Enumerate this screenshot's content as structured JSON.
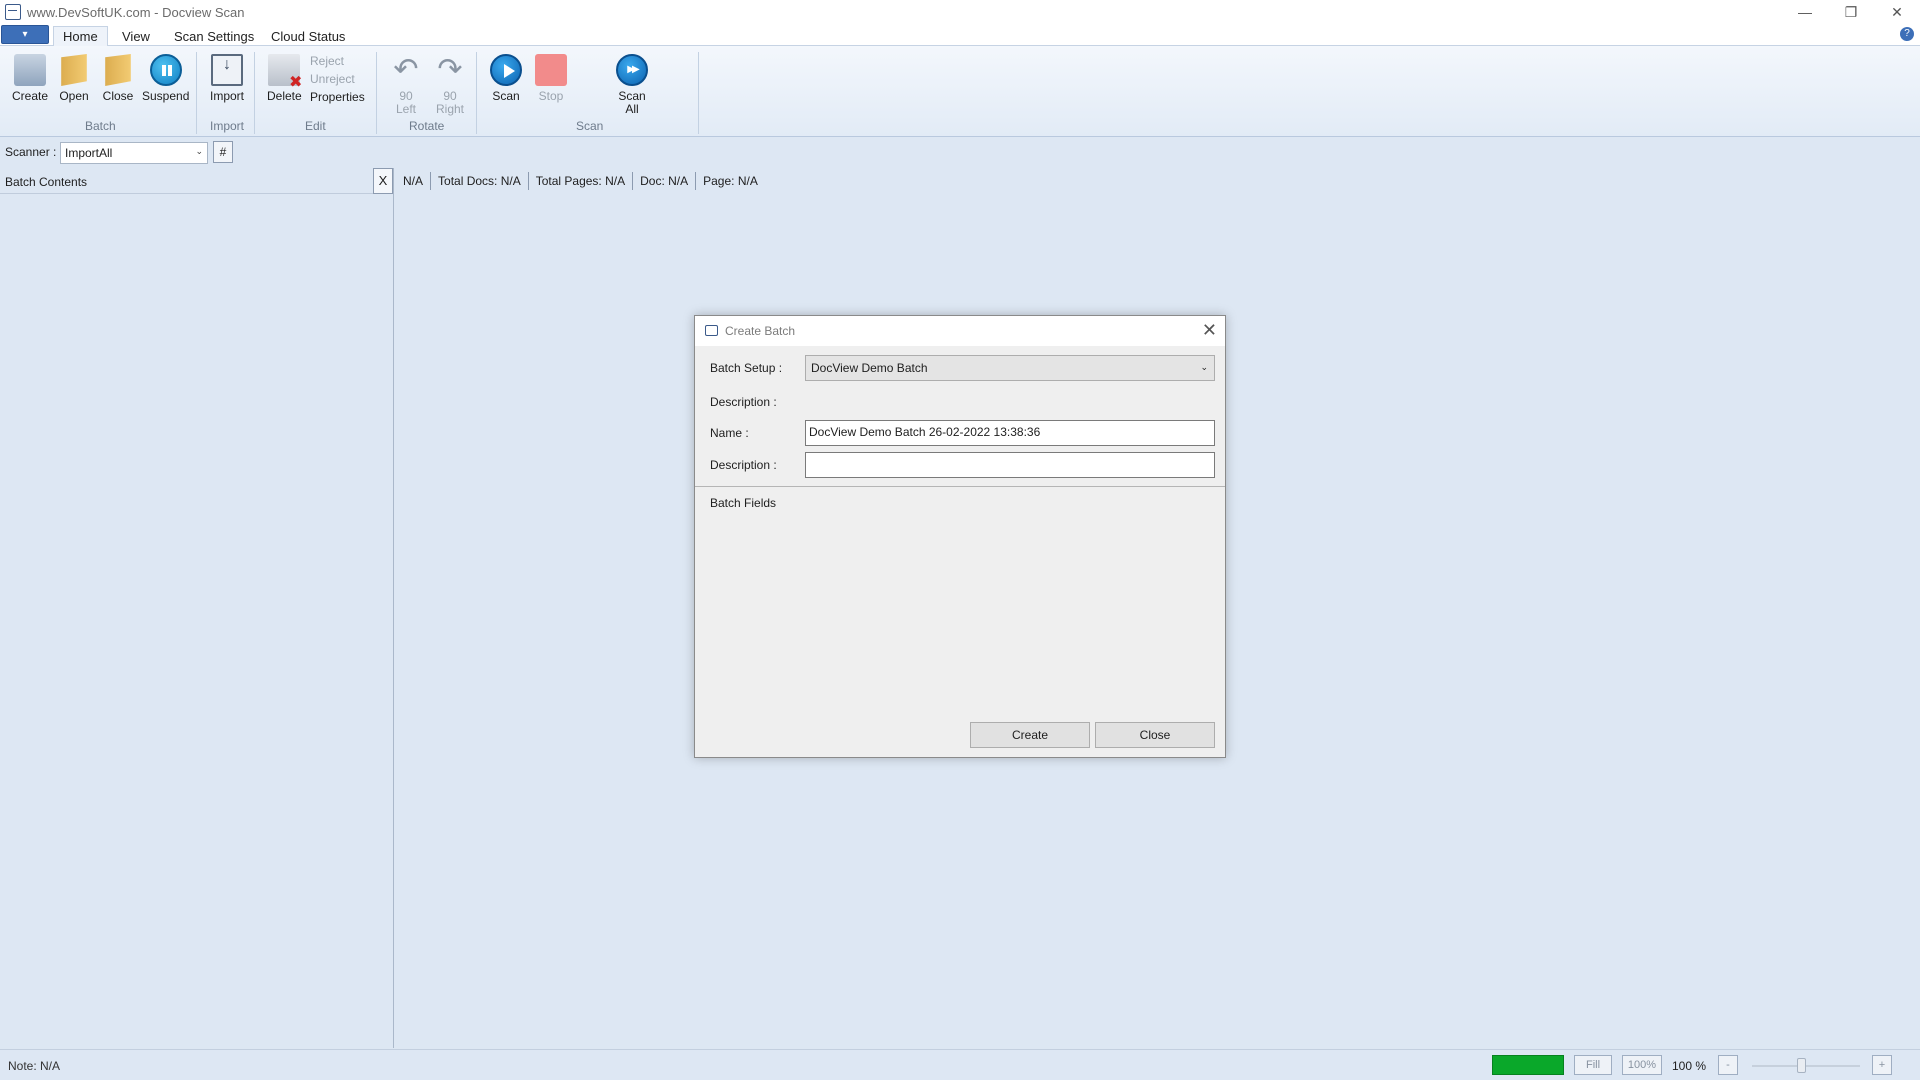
{
  "window": {
    "title": "www.DevSoftUK.com - Docview Scan",
    "controls": {
      "minimize": "—",
      "restore": "❐",
      "close": "✕"
    }
  },
  "ribbon_tabs": [
    "Home",
    "View",
    "Scan Settings",
    "Cloud Status"
  ],
  "ribbon": {
    "batch": {
      "create": "Create",
      "open": "Open",
      "close": "Close",
      "suspend": "Suspend",
      "group": "Batch"
    },
    "import": {
      "import": "Import",
      "group": "Import"
    },
    "edit": {
      "delete": "Delete",
      "reject": "Reject",
      "unreject": "Unreject",
      "properties": "Properties",
      "group": "Edit"
    },
    "rotate": {
      "left_1": "90",
      "left_2": "Left",
      "right_1": "90",
      "right_2": "Right",
      "group": "Rotate"
    },
    "scan": {
      "scan": "Scan",
      "stop": "Stop",
      "scan_all_1": "Scan",
      "scan_all_2": "All",
      "group": "Scan"
    }
  },
  "scanner": {
    "label": "Scanner :",
    "value": "ImportAll",
    "hash_button": "#"
  },
  "left_panel": {
    "title": "Batch Contents",
    "close": "X"
  },
  "info_bar": [
    "N/A",
    "Total Docs: N/A",
    "Total Pages: N/A",
    "Doc: N/A",
    "Page: N/A"
  ],
  "dialog": {
    "title": "Create Batch",
    "batch_setup_label": "Batch Setup :",
    "batch_setup_value": "DocView Demo Batch",
    "description_label": "Description :",
    "name_label": "Name :",
    "name_value": "DocView Demo Batch 26-02-2022 13:38:36",
    "description2_label": "Description :",
    "description2_value": "",
    "batch_fields_label": "Batch Fields",
    "create_button": "Create",
    "close_button": "Close"
  },
  "statusbar": {
    "note": "Note: N/A",
    "fill": "Fill",
    "hundred": "100%",
    "zoom": "100 %",
    "minus": "-",
    "plus": "+",
    "status_color": "#0aa82a"
  }
}
